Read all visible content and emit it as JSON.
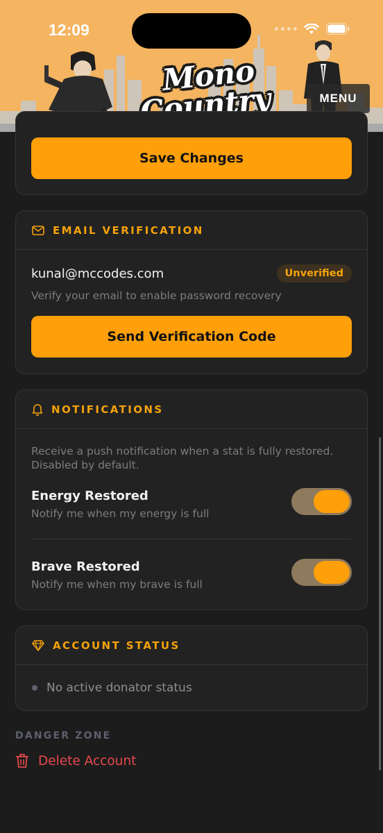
{
  "status_bar": {
    "time": "12:09"
  },
  "header": {
    "logo_line1": "Mono",
    "logo_line2": "Country",
    "menu_label": "MENU"
  },
  "profile": {
    "save_label": "Save Changes"
  },
  "email": {
    "title": "EMAIL VERIFICATION",
    "address": "kunal@mccodes.com",
    "badge": "Unverified",
    "hint": "Verify your email to enable password recovery",
    "send_label": "Send Verification Code"
  },
  "notifications": {
    "title": "NOTIFICATIONS",
    "description": "Receive a push notification when a stat is fully restored. Disabled by default.",
    "items": [
      {
        "title": "Energy Restored",
        "subtitle": "Notify me when my energy is full",
        "enabled": true
      },
      {
        "title": "Brave Restored",
        "subtitle": "Notify me when my brave is full",
        "enabled": true
      }
    ]
  },
  "account": {
    "title": "ACCOUNT STATUS",
    "status": "No active donator status"
  },
  "danger": {
    "heading": "DANGER ZONE",
    "delete_label": "Delete Account"
  },
  "colors": {
    "accent": "#ff9f0a",
    "background": "#1c1c1c",
    "card": "#222222",
    "danger": "#e5484d",
    "header": "#f4b460"
  },
  "icons": [
    "mail-icon",
    "bell-icon",
    "diamond-icon",
    "trash-icon",
    "wifi-icon",
    "battery-icon"
  ]
}
